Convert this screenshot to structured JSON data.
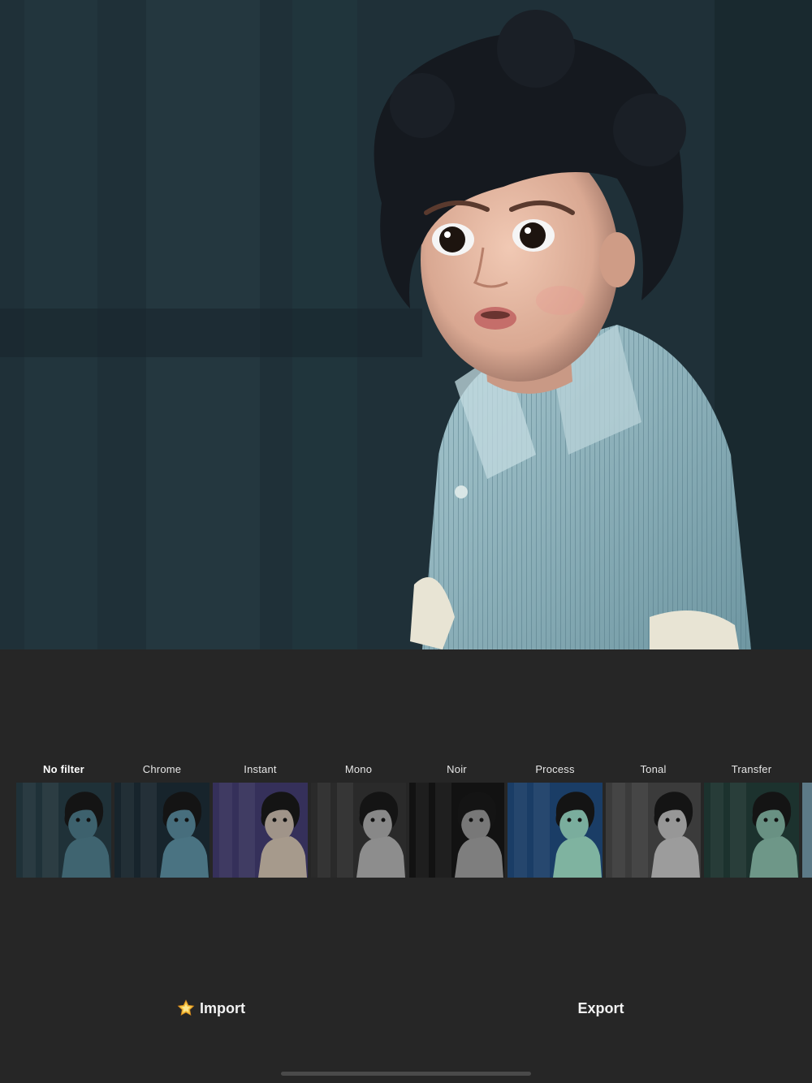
{
  "preview": {
    "description_icon": "photo-preview"
  },
  "filters": [
    {
      "label": "No filter",
      "selected": true,
      "tint": "#3f6470",
      "bg": "#1f3138"
    },
    {
      "label": "Chrome",
      "selected": false,
      "tint": "#4a7382",
      "bg": "#17242c"
    },
    {
      "label": "Instant",
      "selected": false,
      "tint": "#a69a8c",
      "bg": "#35305a"
    },
    {
      "label": "Mono",
      "selected": false,
      "tint": "#8d8d8d",
      "bg": "#2a2a2a"
    },
    {
      "label": "Noir",
      "selected": false,
      "tint": "#7e7e7e",
      "bg": "#121212"
    },
    {
      "label": "Process",
      "selected": false,
      "tint": "#7fb3a0",
      "bg": "#1a3d66"
    },
    {
      "label": "Tonal",
      "selected": false,
      "tint": "#9c9c9c",
      "bg": "#3b3b3b"
    },
    {
      "label": "Transfer",
      "selected": false,
      "tint": "#6e9788",
      "bg": "#1c322e"
    }
  ],
  "actions": {
    "import_label": "Import",
    "import_icon": "star-icon",
    "export_label": "Export"
  }
}
